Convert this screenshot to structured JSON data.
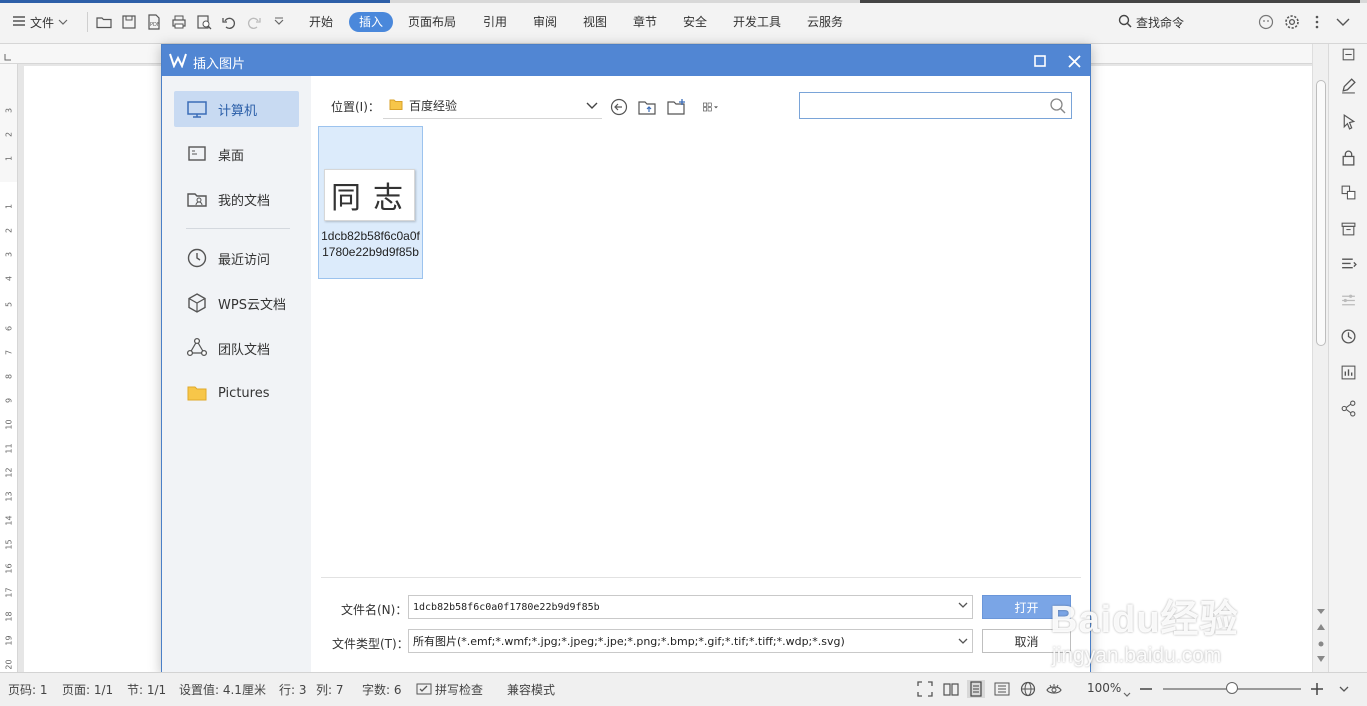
{
  "app": {
    "file_menu_label": "文件",
    "tabs": [
      "开始",
      "插入",
      "页面布局",
      "引用",
      "审阅",
      "视图",
      "章节",
      "安全",
      "开发工具",
      "云服务"
    ],
    "active_tab": "插入",
    "search_label": "查找命令"
  },
  "ruler": {
    "vertical_numbers": [
      "3",
      "2",
      "1",
      "1",
      "2",
      "3",
      "4",
      "5",
      "6",
      "7",
      "8",
      "9",
      "10",
      "11",
      "12",
      "13",
      "14",
      "15",
      "16",
      "17",
      "18",
      "19",
      "20"
    ]
  },
  "dialog": {
    "title": "插入图片",
    "nav": [
      {
        "label": "计算机",
        "icon": "monitor-icon",
        "selected": true
      },
      {
        "label": "桌面",
        "icon": "desktop-icon",
        "selected": false
      },
      {
        "label": "我的文档",
        "icon": "my-documents-icon",
        "selected": false
      },
      {
        "label": "最近访问",
        "icon": "clock-icon",
        "selected": false
      },
      {
        "label": "WPS云文档",
        "icon": "cube-icon",
        "selected": false
      },
      {
        "label": "团队文档",
        "icon": "team-icon",
        "selected": false
      },
      {
        "label": "Pictures",
        "icon": "folder-icon",
        "selected": false
      }
    ],
    "location_label": "位置(I)：",
    "location_value": "百度经验",
    "search_placeholder": "",
    "files": [
      {
        "name": "1dcb82b58f6c0a0f1780e22b9d9f85b",
        "thumbnail_text": "同志"
      }
    ],
    "filename_label": "文件名(N)：",
    "filename_value": "1dcb82b58f6c0a0f1780e22b9d9f85b",
    "filetype_label": "文件类型(T)：",
    "filetype_value": "所有图片(*.emf;*.wmf;*.jpg;*.jpeg;*.jpe;*.png;*.bmp;*.gif;*.tif;*.tiff;*.wdp;*.svg)",
    "open_button": "打开",
    "cancel_button": "取消"
  },
  "status": {
    "page_num": "页码: 1",
    "pages": "页面: 1/1",
    "section": "节: 1/1",
    "setting": "设置值: 4.1厘米",
    "row": "行: 3",
    "col": "列: 7",
    "word_count": "字数: 6",
    "spell_check": "拼写检查",
    "compat_mode": "兼容模式",
    "zoom": "100%"
  },
  "watermark": {
    "brand": "Baidu经验",
    "site": "jingyan.baidu.com"
  },
  "colors": {
    "accent": "#4a88db",
    "dialog_title": "#5186d3",
    "selection": "#c8daf2"
  }
}
